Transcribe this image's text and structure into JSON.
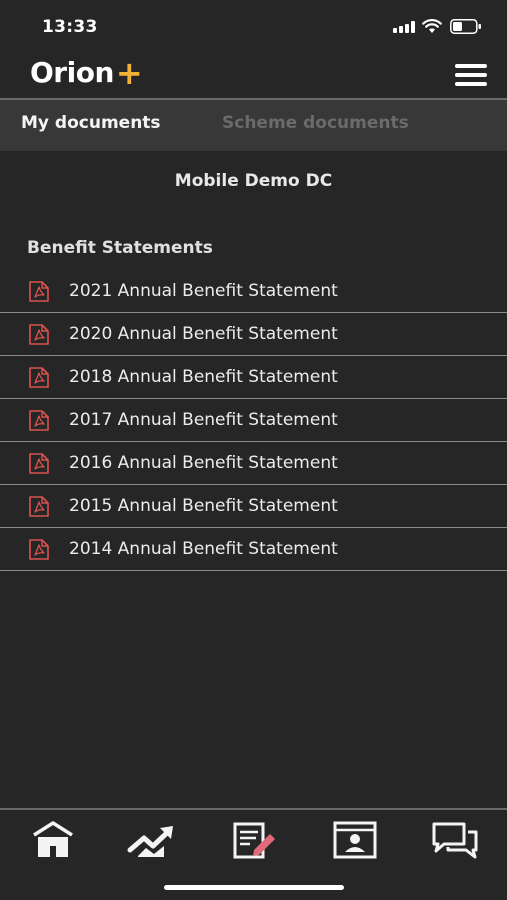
{
  "status_bar": {
    "time": "13:33",
    "icons": [
      "signal-icon",
      "wifi-icon",
      "battery-icon"
    ]
  },
  "header": {
    "logo_text": "Orion",
    "logo_plus": "+",
    "menu_icon": "hamburger-menu-icon",
    "brand_color": "#f2b134"
  },
  "tabs": [
    {
      "label": "My documents",
      "active": true
    },
    {
      "label": "Scheme documents",
      "active": false
    }
  ],
  "member_name": "Mobile Demo DC",
  "section_heading": "Benefit Statements",
  "documents": [
    {
      "label": "2021 Annual Benefit Statement",
      "icon": "pdf-icon"
    },
    {
      "label": "2020 Annual Benefit Statement",
      "icon": "pdf-icon"
    },
    {
      "label": "2018 Annual Benefit Statement",
      "icon": "pdf-icon"
    },
    {
      "label": "2017 Annual Benefit Statement",
      "icon": "pdf-icon"
    },
    {
      "label": "2016 Annual Benefit Statement",
      "icon": "pdf-icon"
    },
    {
      "label": "2015 Annual Benefit Statement",
      "icon": "pdf-icon"
    },
    {
      "label": "2014 Annual Benefit Statement",
      "icon": "pdf-icon"
    }
  ],
  "pdf_icon_color": "#d9534f",
  "bottom_nav": [
    {
      "icon": "home-icon"
    },
    {
      "icon": "growth-chart-icon"
    },
    {
      "icon": "edit-document-icon"
    },
    {
      "icon": "profile-card-icon"
    },
    {
      "icon": "chat-icon"
    }
  ]
}
